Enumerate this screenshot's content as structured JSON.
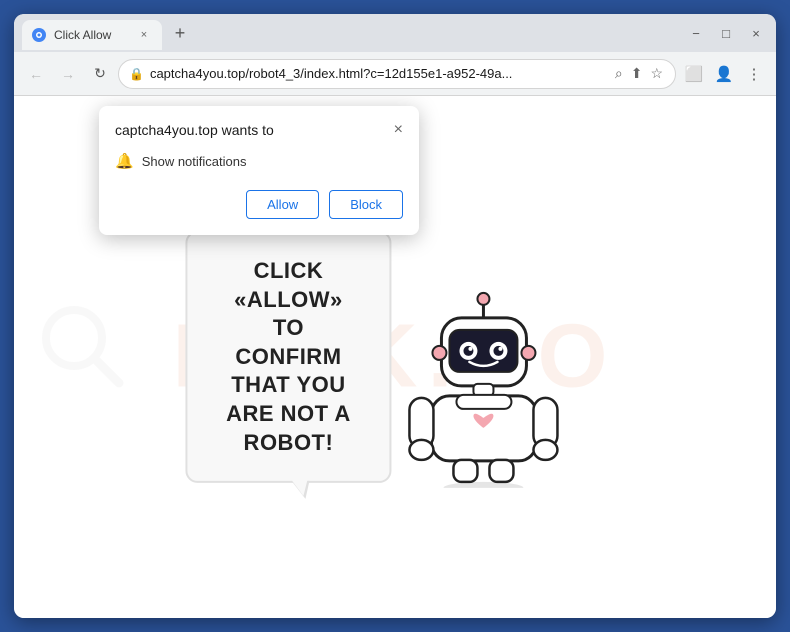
{
  "browser": {
    "title": "Click Allow",
    "tab": {
      "favicon": "C",
      "title": "Click Allow",
      "close_label": "×"
    },
    "new_tab_label": "+",
    "window_controls": {
      "minimize": "−",
      "maximize": "□",
      "close": "×"
    },
    "nav": {
      "back_arrow": "←",
      "forward_arrow": "→",
      "refresh": "↻"
    },
    "address_bar": {
      "lock_icon": "🔒",
      "url": "captcha4you.top/robot4_3/index.html?c=12d155e1-a952-49a...",
      "search_icon": "⌕",
      "share_icon": "⬆",
      "bookmark_icon": "☆",
      "split_icon": "⬜",
      "account_icon": "👤",
      "menu_icon": "⋮"
    }
  },
  "notification_popup": {
    "title": "captcha4you.top wants to",
    "close_label": "×",
    "notification_row": {
      "bell_icon": "🔔",
      "label": "Show notifications"
    },
    "allow_label": "Allow",
    "block_label": "Block"
  },
  "page": {
    "watermark_text": "RISK.CO",
    "captcha_heading_line1": "CLICK «ALLOW» TO CONFIRM THAT YOU",
    "captcha_heading_line2": "ARE NOT A ROBOT!"
  }
}
